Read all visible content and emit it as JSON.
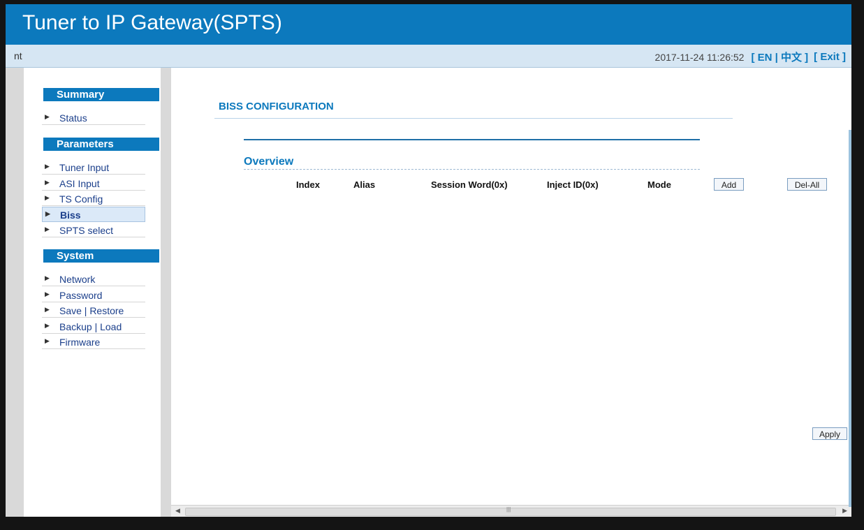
{
  "header": {
    "title": "Tuner to IP Gateway(SPTS)"
  },
  "infobar": {
    "breadcrumb": "nt",
    "datetime": "2017-11-24 11:26:52",
    "lang_toggle": "[ EN | 中文 ]",
    "exit_label": "[ Exit ]"
  },
  "sidebar": {
    "sections": [
      {
        "title": "Summary",
        "items": [
          {
            "label": "Status"
          }
        ]
      },
      {
        "title": "Parameters",
        "items": [
          {
            "label": "Tuner Input"
          },
          {
            "label": "ASI Input"
          },
          {
            "label": "TS Config"
          },
          {
            "label": "Biss",
            "active": true
          },
          {
            "label": "SPTS select"
          }
        ]
      },
      {
        "title": "System",
        "items": [
          {
            "label": "Network"
          },
          {
            "label": "Password"
          },
          {
            "label": "Save | Restore"
          },
          {
            "label": "Backup | Load"
          },
          {
            "label": "Firmware"
          }
        ]
      }
    ]
  },
  "main": {
    "page_title": "BISS CONFIGURATION",
    "overview_title": "Overview",
    "columns": [
      "Index",
      "Alias",
      "Session Word(0x)",
      "Inject ID(0x)",
      "Mode"
    ],
    "add_label": "Add",
    "del_all_label": "Del-All",
    "apply_label": "Apply"
  },
  "colors": {
    "accent": "#0c79bd",
    "infobar": "#d6e6f3",
    "gutter": "#d9d9d9"
  }
}
